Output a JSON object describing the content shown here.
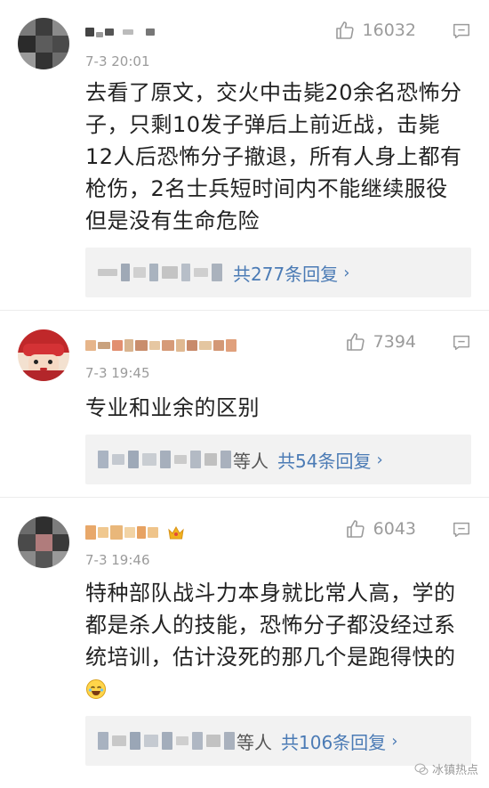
{
  "comments": [
    {
      "time": "7-3 20:01",
      "likes": "16032",
      "text": "去看了原文，交火中击毙20余名恐怖分子，只剩10发子弹后上前近战，击毙12人后恐怖分子撤退，所有人身上都有枪伤，2名士兵短时间内不能继续服役但是没有生命危险",
      "reply_suffix": "",
      "reply_count": "共277条回复"
    },
    {
      "time": "7-3 19:45",
      "likes": "7394",
      "text": "专业和业余的区别",
      "reply_suffix": "等人",
      "reply_count": "共54条回复"
    },
    {
      "time": "7-3 19:46",
      "likes": "6043",
      "text": "特种部队战斗力本身就比常人高，学的都是杀人的技能，恐怖分子都没经过系统培训，估计没死的那几个是跑得快的",
      "reply_suffix": "等人",
      "reply_count": "共106条回复"
    }
  ],
  "icons": {
    "like": "thumbs-up-icon",
    "comment": "comment-icon",
    "chevron": "chevron-right-icon",
    "crown": "crown-badge-icon",
    "emoji": "laughing-emoji-icon",
    "watermark": "wechat-icon"
  },
  "watermark_text": "冰镇热点",
  "colors": {
    "link": "#4b7bb5",
    "meta": "#9b9b9b",
    "reply_bg": "#f2f2f2"
  }
}
